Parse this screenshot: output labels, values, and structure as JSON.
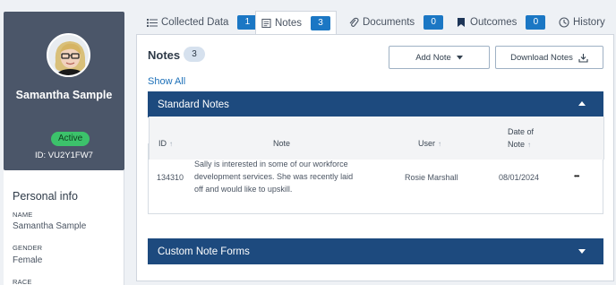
{
  "profile": {
    "name": "Samantha Sample",
    "status": "Active",
    "id_text": "ID: VU2Y1FW7"
  },
  "personal_info": {
    "title": "Personal info",
    "fields": [
      {
        "label": "NAME",
        "value": "Samantha Sample"
      },
      {
        "label": "GENDER",
        "value": "Female"
      },
      {
        "label": "RACE",
        "value": ""
      }
    ]
  },
  "tabs": [
    {
      "label": "Collected Data",
      "count": "1",
      "icon": "list-icon"
    },
    {
      "label": "Notes",
      "count": "3",
      "icon": "notes-icon",
      "active": true
    },
    {
      "label": "Documents",
      "count": "0",
      "icon": "paperclip-icon"
    },
    {
      "label": "Outcomes",
      "count": "0",
      "icon": "flag-icon"
    },
    {
      "label": "History",
      "icon": "clock-icon"
    }
  ],
  "notes": {
    "title": "Notes",
    "count": "3",
    "show_all": "Show All",
    "add_note": "Add Note",
    "download_notes": "Download Notes"
  },
  "standard_notes": {
    "title": "Standard Notes",
    "columns": [
      "ID",
      "Note",
      "User",
      "Date of",
      "Note"
    ],
    "rows": [
      {
        "id": "134310",
        "note_line1": "Sally is interested in some of our workforce",
        "note_line2": "development services. She was recently laid",
        "note_line3": "off and would like to upskill.",
        "user": "Rosie Marshall",
        "date": "08/01/2024",
        "actions": "•••"
      }
    ]
  },
  "custom_forms": {
    "title": "Custom Note Forms"
  },
  "colors": {
    "accent": "#1b77c4",
    "bar": "#1d4a7e",
    "sidebar": "#4b5669",
    "active": "#3cc26b"
  }
}
